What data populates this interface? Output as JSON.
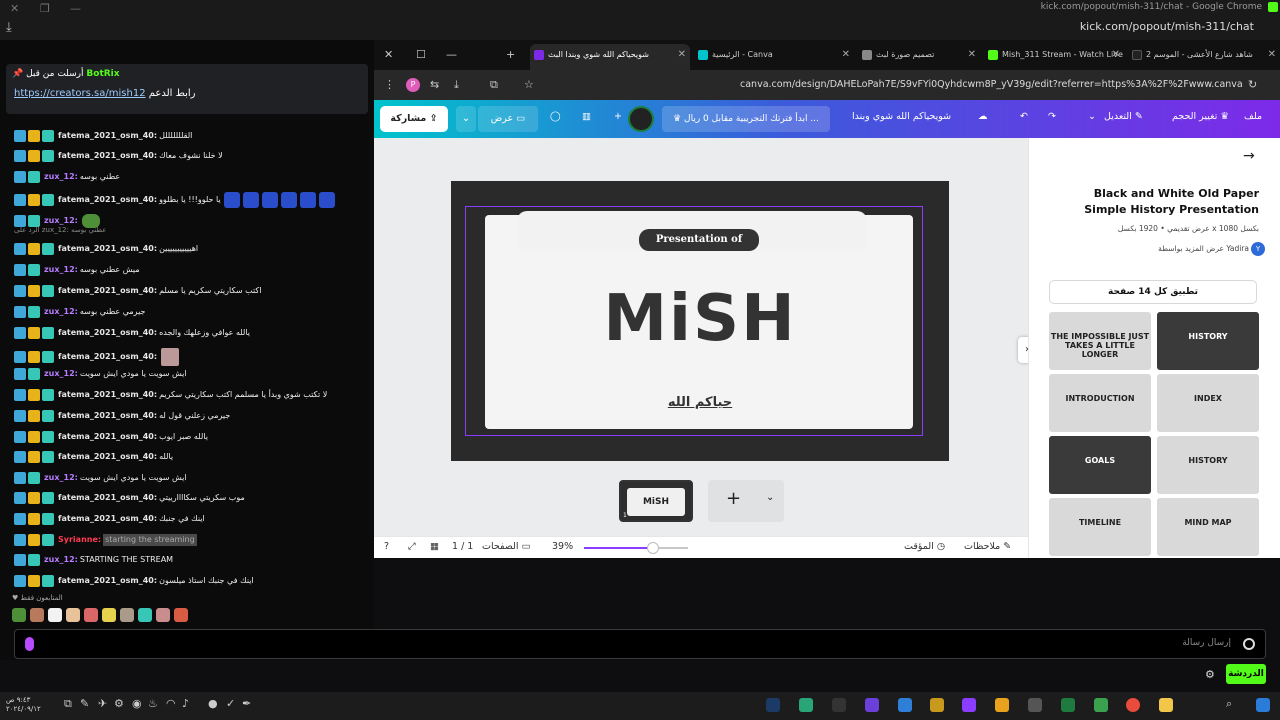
{
  "window": {
    "title": "kick.com/popout/mish-311/chat - Google Chrome",
    "url": "kick.com/popout/mish-311/chat"
  },
  "chat": {
    "pinned": {
      "author": "BotRix",
      "prefix": "أرسلت من قبل",
      "link_label": "رابط الدعم",
      "link": "https://creators.sa/mish12"
    },
    "messages": [
      {
        "user": "fatema_2021_osm_40:",
        "text": "القلللللللل",
        "kind": "fatema"
      },
      {
        "user": "fatema_2021_osm_40:",
        "text": "لا خلنا نشوف معاك",
        "kind": "fatema"
      },
      {
        "user": "zux_12:",
        "text": "عطني بوسه",
        "kind": "zux"
      },
      {
        "user": "fatema_2021_osm_40:",
        "text": "يا حلوو!!! يا بطلوو",
        "kind": "fatema"
      },
      {
        "user": "zux_12:",
        "text": "",
        "kind": "zux"
      },
      {
        "user": "fatema_2021_osm_40:",
        "text": "اهييييييييييين",
        "kind": "fatema"
      },
      {
        "user": "zux_12:",
        "text": "ميش عطني بوسه",
        "kind": "zux"
      },
      {
        "user": "fatema_2021_osm_40:",
        "text": "اكتب سكاريتي سكريم يا مسلم",
        "kind": "fatema"
      },
      {
        "user": "zux_12:",
        "text": "جيرمي عطني بوسه",
        "kind": "zux"
      },
      {
        "user": "fatema_2021_osm_40:",
        "text": "يالله عوافي وزعلهك والجده",
        "kind": "fatema"
      },
      {
        "user": "fatema_2021_osm_40:",
        "text": "",
        "kind": "fatema"
      },
      {
        "user": "zux_12:",
        "text": "ايش سويت يا مودي ايش سويت",
        "kind": "zux"
      },
      {
        "user": "fatema_2021_osm_40:",
        "text": "لا تكتب شوي وبدأ يا مسلمم اكتب سكاريتي سكريم",
        "kind": "fatema"
      },
      {
        "user": "fatema_2021_osm_40:",
        "text": "جيرمي زعلني قول له",
        "kind": "fatema"
      },
      {
        "user": "fatema_2021_osm_40:",
        "text": "يالله صبر ايوب",
        "kind": "fatema"
      },
      {
        "user": "fatema_2021_osm_40:",
        "text": "يالله",
        "kind": "fatema"
      },
      {
        "user": "zux_12:",
        "text": "ايش سويت يا مودي ايش سويت",
        "kind": "zux"
      },
      {
        "user": "fatema_2021_osm_40:",
        "text": "موب سكريتي سكاااارييتي",
        "kind": "fatema"
      },
      {
        "user": "fatema_2021_osm_40:",
        "text": "اينك في جنبك",
        "kind": "fatema"
      },
      {
        "user": "Syrianne:",
        "text": "starting the streaming",
        "kind": "syr"
      },
      {
        "user": "zux_12:",
        "text": "STARTING THE STREAM",
        "kind": "zux"
      },
      {
        "user": "fatema_2021_osm_40:",
        "text": "اينك في جنبك استاذ ميلسون",
        "kind": "fatema"
      }
    ],
    "reply_hint": "الرد على zux_12: عطني بوسه",
    "mods_label": "المتابعون فقط",
    "input_placeholder": "إرسال رسالة",
    "send_label": "الدردشة"
  },
  "browser": {
    "tabs": [
      {
        "label": "شاهد شارع الأعشى - الموسم 2"
      },
      {
        "label": "Mish_311 Stream - Watch Live"
      },
      {
        "label": "تصميم صورة لبث"
      },
      {
        "label": "الرئيسية - Canva"
      },
      {
        "label": "شويحياكم الله شوي وبندا البث"
      }
    ],
    "url": "canva.com/design/DAHELoPah7E/S9vFYi0Qyhdcwm8P_yV39g/edit?referrer=https%3A%2F%2Fwww.canva.com%2F",
    "profile": "P"
  },
  "canva": {
    "menu": {
      "file": "ملف",
      "resize": "تغيير الحجم",
      "edit": "التعديل",
      "design_title": "شويحياكم الله شوي وبندا",
      "trial": "ابدأ فترتك التجريبية مقابل 0 ريال ...",
      "present": "عرض",
      "share": "مشاركة"
    },
    "slide": {
      "badge": "Presentation of",
      "title": "MiSH",
      "subtitle": "حياكم الله"
    },
    "thumb": {
      "title": "MiSH",
      "number": "1"
    },
    "bottom": {
      "notes": "ملاحظات",
      "timer": "المؤقت",
      "zoom": "39%",
      "zoom_fraction": 0.39,
      "pages": "الصفحات",
      "page_count": "1 / 1"
    },
    "panel": {
      "template_title": "Black and White Old Paper Simple History Presentation",
      "meta": "عرض تقديمي • 1920 بكسل x 1080 بكسل",
      "author": "عرض المزيد بواسطة Yadira",
      "author_initial": "Y",
      "apply": "تطبيق كل 14 صفحة",
      "templates": [
        "THE IMPOSSIBLE JUST TAKES A LITTLE LONGER",
        "HISTORY",
        "INTRODUCTION",
        "INDEX",
        "GOALS",
        "HISTORY",
        "TIMELINE",
        "MIND MAP"
      ]
    }
  },
  "taskbar": {
    "time": "٩:٤٣ ص",
    "date": "٢٠٢٤/٠٩/١٢"
  },
  "colors": {
    "kick_green": "#53fc18",
    "canva_purple": "#8b3dff"
  }
}
